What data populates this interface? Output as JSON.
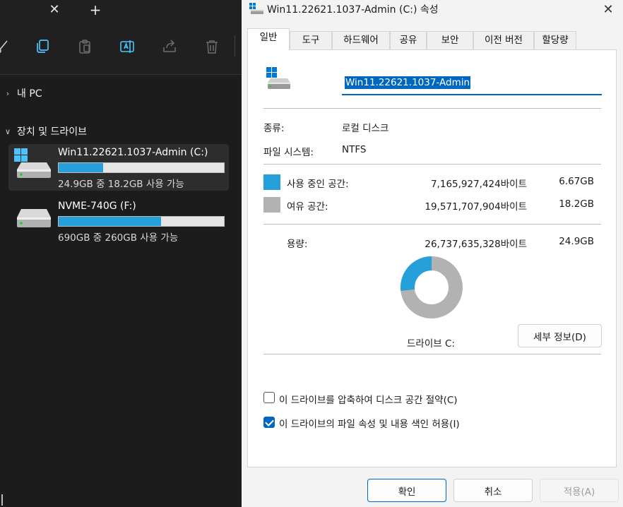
{
  "explorer": {
    "tab_close_glyph": "✕",
    "tab_add_glyph": "+",
    "toolbar_icons": [
      "cut-icon",
      "copy-icon",
      "paste-icon",
      "rename-icon",
      "share-icon",
      "delete-icon"
    ],
    "nav": {
      "this_pc": {
        "chevron": "›",
        "label": "내 PC"
      },
      "devices": {
        "chevron": "∨",
        "label": "장치 및 드라이브"
      }
    },
    "drives": [
      {
        "name": "Win11.22621.1037-Admin (C:)",
        "used_fraction": 0.27,
        "subtitle": "24.9GB 중 18.2GB 사용 가능"
      },
      {
        "name": "NVME-740G (F:)",
        "used_fraction": 0.62,
        "subtitle": "690GB 중 260GB 사용 가능"
      }
    ]
  },
  "dialog": {
    "title": "Win11.22621.1037-Admin (C:) 속성",
    "close_glyph": "✕",
    "tabs": [
      "일반",
      "도구",
      "하드웨어",
      "공유",
      "보안",
      "이전 버전",
      "할당량"
    ],
    "drive_name_value": "Win11.22621.1037-Admin",
    "type_label": "종류:",
    "type_value": "로컬 디스크",
    "fs_label": "파일 시스템:",
    "fs_value": "NTFS",
    "used_label": "사용 중인 공간:",
    "used_bytes": "7,165,927,424바이트",
    "used_gb": "6.67GB",
    "free_label": "여유 공간:",
    "free_bytes": "19,571,707,904바이트",
    "free_gb": "18.2GB",
    "capacity_label": "용량:",
    "capacity_bytes": "26,737,635,328바이트",
    "capacity_gb": "24.9GB",
    "drive_caption": "드라이브 C:",
    "details_button": "세부 정보(D)",
    "compress_label": "이 드라이브를 압축하여 디스크 공간 절약(C)",
    "compress_checked": false,
    "index_label": "이 드라이브의 파일 속성 및 내용 색인 허용(I)",
    "index_checked": true,
    "used_fraction": 0.268,
    "colors": {
      "used": "#26a0da",
      "free": "#b2b2b2",
      "accent": "#0067c0"
    },
    "buttons": {
      "ok": "확인",
      "cancel": "취소",
      "apply": "적용(A)"
    }
  }
}
